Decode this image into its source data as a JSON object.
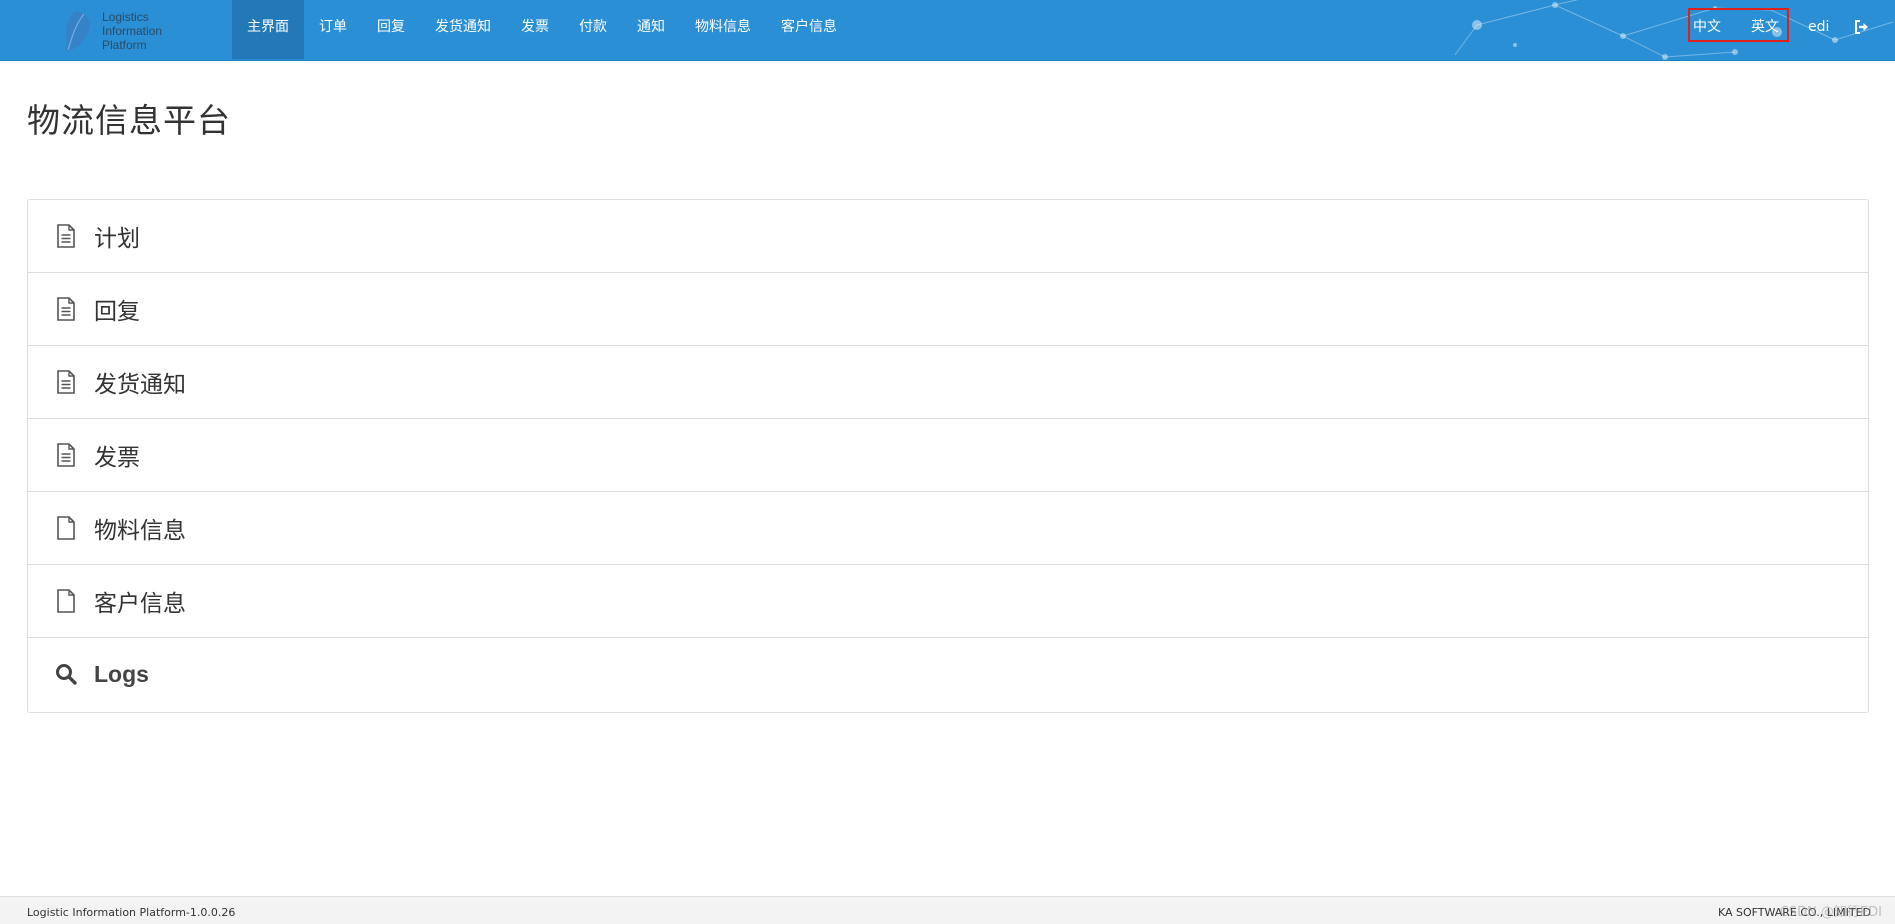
{
  "logo": {
    "line1": "Logistics",
    "line2": "Information",
    "line3": "Platform"
  },
  "nav": {
    "items": [
      {
        "label": "主界面",
        "active": true
      },
      {
        "label": "订单"
      },
      {
        "label": "回复"
      },
      {
        "label": "发货通知"
      },
      {
        "label": "发票"
      },
      {
        "label": "付款"
      },
      {
        "label": "通知"
      },
      {
        "label": "物料信息"
      },
      {
        "label": "客户信息"
      }
    ],
    "lang_zh": "中文",
    "lang_en": "英文",
    "user": "edi",
    "logout_icon": "sign-out-icon"
  },
  "main": {
    "title": "物流信息平台",
    "list": [
      {
        "label": "计划",
        "icon": "file-text-icon"
      },
      {
        "label": "回复",
        "icon": "file-text-icon"
      },
      {
        "label": "发货通知",
        "icon": "file-text-icon"
      },
      {
        "label": "发票",
        "icon": "file-text-icon"
      },
      {
        "label": "物料信息",
        "icon": "file-icon"
      },
      {
        "label": "客户信息",
        "icon": "file-icon"
      },
      {
        "label": "Logs",
        "icon": "search-icon"
      }
    ]
  },
  "footer": {
    "left": "Logistic Information Platform-1.0.0.26",
    "right": "KA SOFTWARE CO., LIMITED",
    "watermark": "CSDN @知行EDI"
  },
  "colors": {
    "nav_bg": "#2a8fd4",
    "nav_active": "#2379b8",
    "highlight_box": "#e0201a"
  }
}
